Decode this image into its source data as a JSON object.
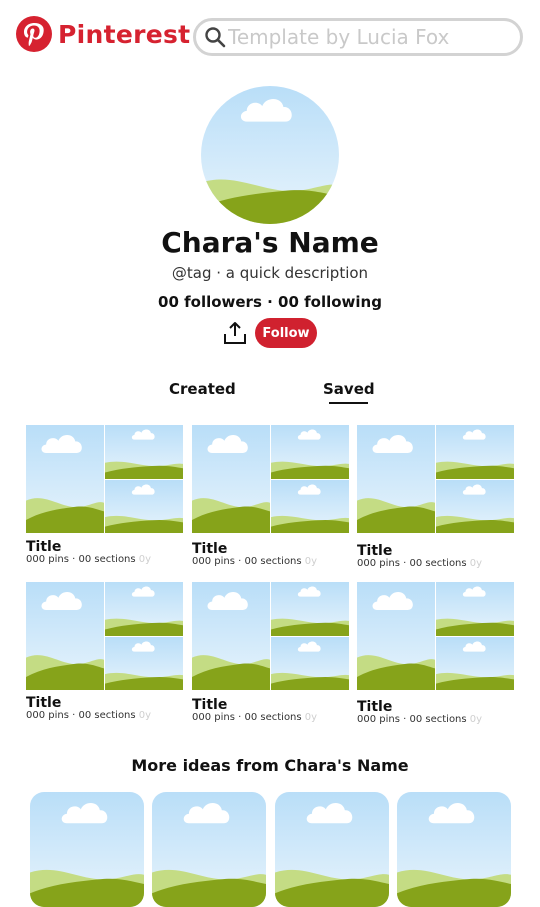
{
  "header": {
    "brand": "Pinterest",
    "search_placeholder": "Template by Lucia Fox"
  },
  "profile": {
    "name": "Chara's Name",
    "tagline": "@tag · a quick description",
    "stats": "00 followers · 00 following",
    "follow_label": "Follow"
  },
  "tabs": [
    {
      "label": "Created",
      "active": false
    },
    {
      "label": "Saved",
      "active": true
    }
  ],
  "boards": [
    {
      "title": "Title",
      "meta": "000 pins · 00 sections",
      "age": "0y"
    },
    {
      "title": "Title",
      "meta": "000 pins · 00 sections",
      "age": "0y"
    },
    {
      "title": "Title",
      "meta": "000 pins · 00 sections",
      "age": "0y"
    },
    {
      "title": "Title",
      "meta": "000 pins · 00 sections",
      "age": "0y"
    },
    {
      "title": "Title",
      "meta": "000 pins · 00 sections",
      "age": "0y"
    },
    {
      "title": "Title",
      "meta": "000 pins · 00 sections",
      "age": "0y"
    }
  ],
  "more_ideas": {
    "title": "More ideas from Chara's Name"
  },
  "colors": {
    "brand": "#d62230",
    "follow": "#d0212f",
    "sky": "#cfe8fa",
    "grass_light": "#c4dc84",
    "grass_dark": "#86a31a"
  }
}
